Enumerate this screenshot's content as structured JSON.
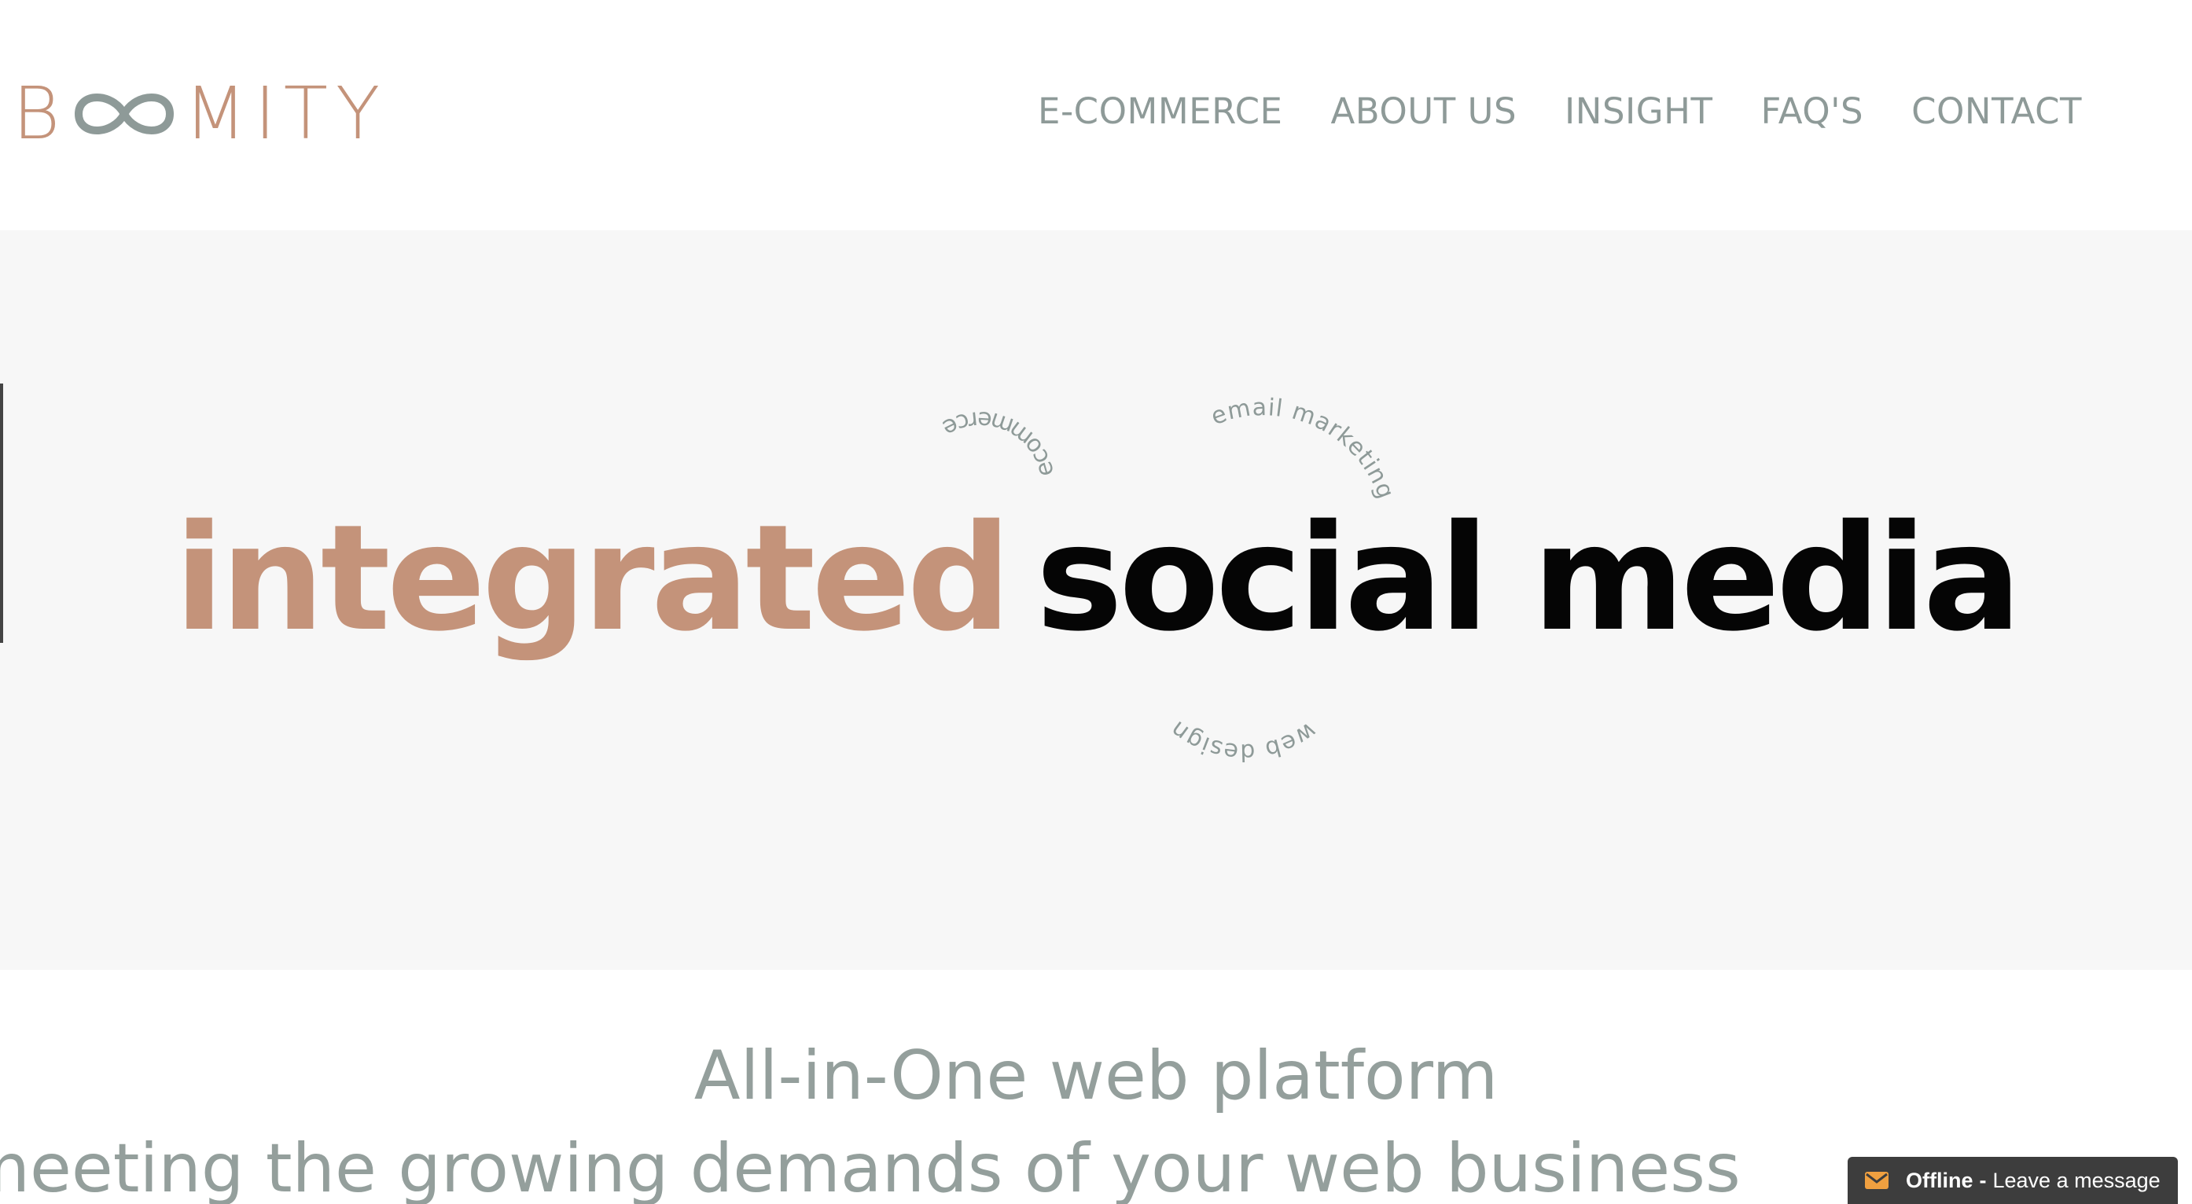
{
  "header": {
    "logo": {
      "first": "B",
      "infinity_icon": "infinity-icon",
      "rest": "MITY",
      "colors": {
        "brand": "#c4937a",
        "infinity": "#8e9a98"
      }
    },
    "nav": [
      {
        "label": "E-COMMERCE"
      },
      {
        "label": "ABOUT US"
      },
      {
        "label": "INSIGHT"
      },
      {
        "label": "FAQ'S"
      },
      {
        "label": "CONTACT"
      }
    ]
  },
  "hero": {
    "headline": {
      "accent": "integrated",
      "rest": "social media"
    },
    "rotating_words": [
      "ecommerce",
      "email marketing",
      "web design"
    ],
    "colors": {
      "background": "#f7f7f7",
      "accent": "#c4937a",
      "text": "#050505",
      "orbit_text": "#8e9a98"
    }
  },
  "tagline": {
    "line1": "All-in-One web platform",
    "line2": "meeting the growing demands of your web business"
  },
  "chat": {
    "icon": "mail-icon",
    "status": "Offline",
    "separator": "-",
    "message": "Leave a message",
    "colors": {
      "background": "#3d3d3d",
      "icon": "#f0a040"
    }
  }
}
